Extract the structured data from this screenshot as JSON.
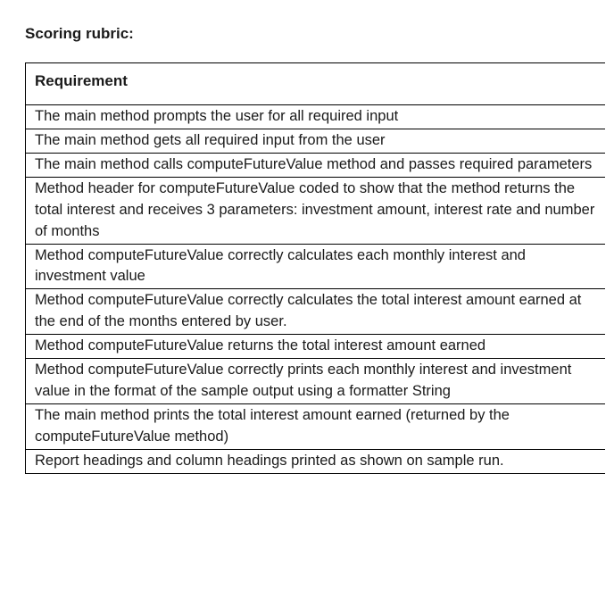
{
  "title": "Scoring rubric:",
  "header": "Requirement",
  "rows": [
    "The main method prompts the user for all required input",
    "The main method gets all required input from the user",
    "The main method calls computeFutureValue method and passes required parameters",
    "Method header for computeFutureValue coded to show that the method returns the total interest and receives 3 parameters: investment amount, interest rate and number of months",
    "Method computeFutureValue correctly calculates each monthly interest and investment value",
    "Method computeFutureValue correctly calculates the total interest amount earned at the end of the months entered by user.",
    "Method computeFutureValue returns the total interest amount earned",
    "Method computeFutureValue correctly prints each monthly interest and investment value in the format of the sample output using a formatter String",
    "The main method prints the total interest amount earned (returned by the computeFutureValue method)",
    "Report headings and column headings printed as shown on sample run."
  ]
}
